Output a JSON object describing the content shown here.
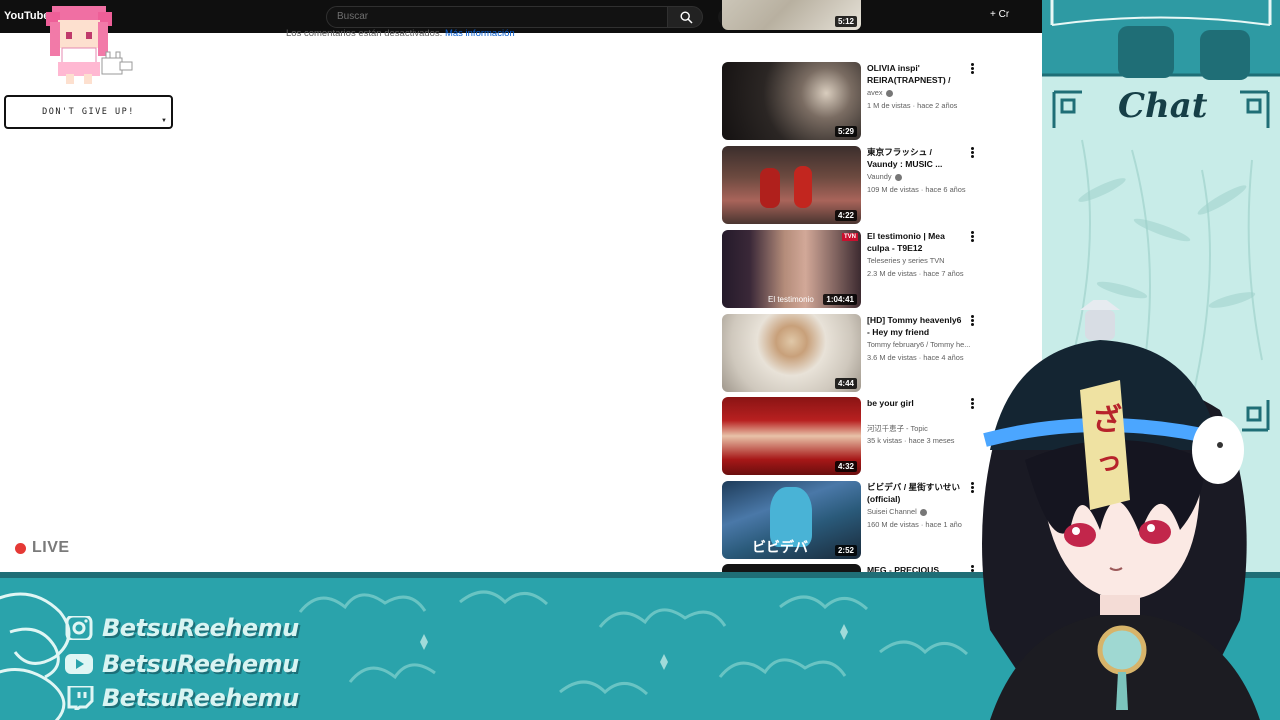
{
  "browser": {
    "logo_text": "YouTube",
    "search_placeholder": "Buscar",
    "create_label": "+ Cr",
    "comments_disabled": "Los comentarios están desactivados.",
    "comments_link": "Más información"
  },
  "recommendations": [
    {
      "title": "",
      "channel": "",
      "views": "",
      "duration": "5:12"
    },
    {
      "title": "OLIVIA inspi' REIRA(TRAPNEST) / a...",
      "channel": "avex",
      "views": "1 M de vistas · hace 2 años",
      "duration": "5:29"
    },
    {
      "title": "東京フラッシュ / Vaundy : MUSIC ...",
      "channel": "Vaundy",
      "views": "109 M de vistas · hace 6 años",
      "duration": "4:22"
    },
    {
      "title": "El testimonio | Mea culpa - T9E12",
      "channel": "Teleseries y series TVN",
      "views": "2.3 M de vistas · hace 7 años",
      "duration": "1:04:41",
      "thumb_caption": "El testimonio",
      "thumb_badge": "TVN"
    },
    {
      "title": "[HD] Tommy heavenly6 - Hey my friend",
      "channel": "Tommy february6 / Tommy he...",
      "views": "3.6 M de vistas · hace 4 años",
      "duration": "4:44"
    },
    {
      "title": "be your girl",
      "channel": "河辺千恵子 - Topic",
      "views": "35 k vistas · hace 3 meses",
      "duration": "4:32"
    },
    {
      "title": "ビビデバ / 星街すいせい(official)",
      "channel": "Suisei Channel",
      "views": "160 M de vistas · hace 1 año",
      "duration": "2:52",
      "thumb_caption": "ビビデバ"
    },
    {
      "title": "MEG - PRECIOUS",
      "channel": "",
      "views": "",
      "duration": ""
    }
  ],
  "overlay": {
    "speech_text": "DON'T GIVE UP!",
    "live_label": "LIVE",
    "chat_title": "Chat",
    "socials": [
      {
        "icon": "instagram-icon",
        "handle": "BetsuReehemu"
      },
      {
        "icon": "youtube-icon",
        "handle": "BetsuReehemu"
      },
      {
        "icon": "twitch-icon",
        "handle": "BetsuReehemu"
      }
    ],
    "avatar_hat_text": "ざっこ"
  },
  "colors": {
    "teal_banner": "#2aa3ab",
    "chat_bg": "#c8ece8",
    "chat_title": "#163f47",
    "live_red": "#e53935",
    "link_blue": "#065fd4"
  }
}
